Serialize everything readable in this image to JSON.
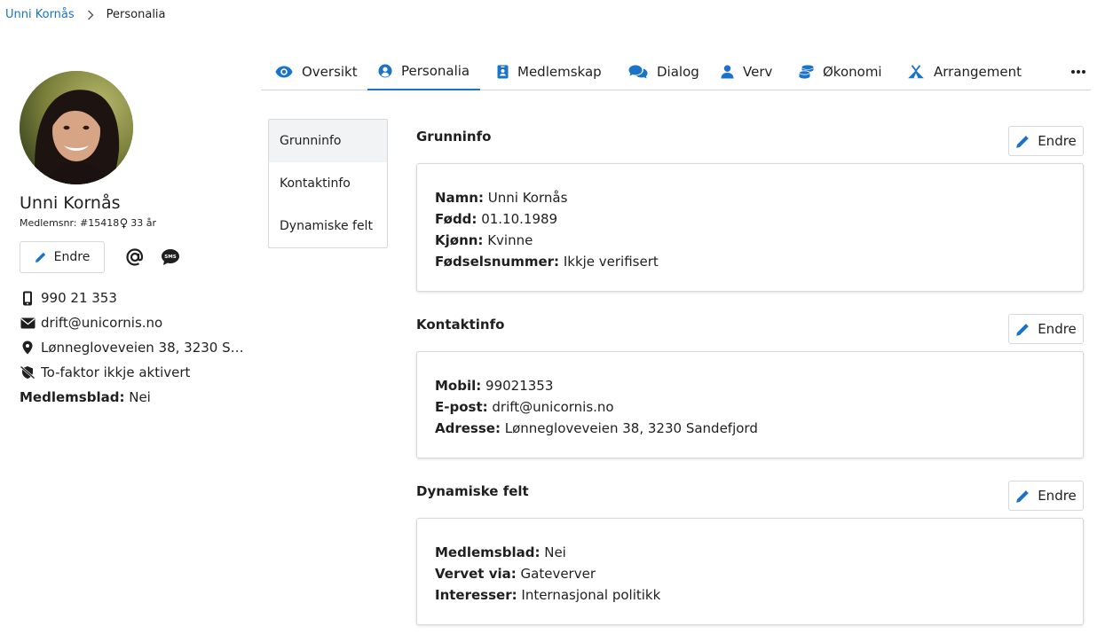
{
  "breadcrumb": {
    "parent": "Unni Kornås",
    "current": "Personalia"
  },
  "profile": {
    "name": "Unni Kornås",
    "member_no": "Medlemsnr: #15418",
    "age": "33 år",
    "edit_label": "Endre",
    "phone": "990 21 353",
    "email": "drift@unicornis.no",
    "address": "Lønnegloveveien 38, 3230 San...",
    "two_factor": "To-faktor ikkje aktivert",
    "newsletter_label": "Medlemsblad:",
    "newsletter_value": "Nei"
  },
  "tabs": [
    {
      "label": "Oversikt",
      "icon": "eye-icon"
    },
    {
      "label": "Personalia",
      "icon": "user-circle-icon"
    },
    {
      "label": "Medlemskap",
      "icon": "id-badge-icon"
    },
    {
      "label": "Dialog",
      "icon": "comments-icon"
    },
    {
      "label": "Verv",
      "icon": "user-icon"
    },
    {
      "label": "Økonomi",
      "icon": "coins-icon"
    },
    {
      "label": "Arrangement",
      "icon": "campground-icon"
    }
  ],
  "subnav": [
    "Grunninfo",
    "Kontaktinfo",
    "Dynamiske felt"
  ],
  "edit_label": "Endre",
  "sections": {
    "grunninfo": {
      "title": "Grunninfo",
      "fields": [
        {
          "label": "Namn:",
          "value": "Unni Kornås"
        },
        {
          "label": "Fødd:",
          "value": "01.10.1989"
        },
        {
          "label": "Kjønn:",
          "value": "Kvinne"
        },
        {
          "label": "Fødselsnummer:",
          "value": "Ikkje verifisert"
        }
      ]
    },
    "kontaktinfo": {
      "title": "Kontaktinfo",
      "fields": [
        {
          "label": "Mobil:",
          "value": "99021353"
        },
        {
          "label": "E-post:",
          "value": "drift@unicornis.no"
        },
        {
          "label": "Adresse:",
          "value": "Lønnegloveveien 38, 3230 Sandefjord"
        }
      ]
    },
    "dynamiske": {
      "title": "Dynamiske felt",
      "fields": [
        {
          "label": "Medlemsblad:",
          "value": "Nei"
        },
        {
          "label": "Vervet via:",
          "value": "Gateverver"
        },
        {
          "label": "Interesser:",
          "value": "Internasjonal politikk"
        }
      ]
    }
  },
  "colors": {
    "accent": "#1a73c8",
    "text": "#1f1f1f",
    "border": "#d5d8dc"
  }
}
